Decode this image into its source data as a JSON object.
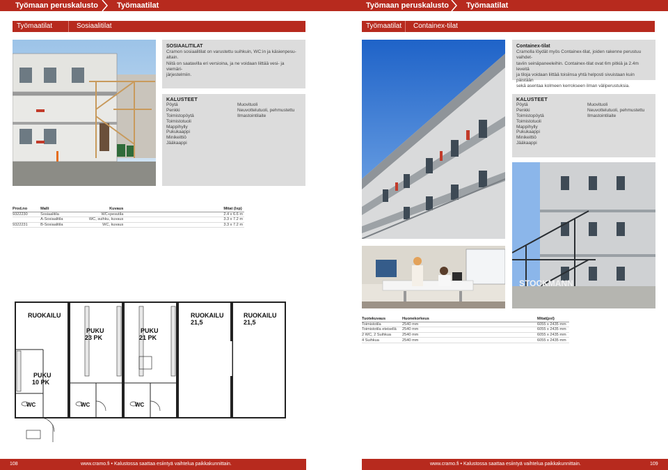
{
  "header": {
    "left_section": "Työmaan peruskalusto",
    "left_page": "Työmaatilat",
    "right_section": "Työmaan peruskalusto",
    "right_page": "Työmaatilat"
  },
  "left_page": {
    "bar_category": "Työmaatilat",
    "bar_subcategory": "Sosiaalitilat",
    "info_title": "SOSIAALITILAT",
    "info_text_1": "Cramon sosiaalitilat on varustettu suihkuin, WC:in ja käsienpesu-",
    "info_text_2": "altain.",
    "info_text_3": "Niitä on saatavilla eri versioina, ja ne voidaan liittää vesi- ja viemäri-",
    "info_text_4": "järjestelmiin.",
    "furniture_title": "KALUSTEET",
    "furniture_col1": [
      "Pöytä",
      "Penkki",
      "Toimistopöytä",
      "Toimistotuoli",
      "Mappihylly",
      "Pukukaappi",
      "Minikeittiö",
      "Jääkaappi"
    ],
    "furniture_col2": [
      "Muovituoli",
      "Neuvottelutuoli, pehmustettu",
      "Ilmastointilaite"
    ],
    "table_headers": [
      "Prod.no",
      "Malli",
      "Kuvaus",
      "Mitat (lxp)"
    ],
    "table_rows": [
      [
        "9322230",
        "Sosiaalitila",
        "WC+pesutila",
        "2.4 x 6.6 m"
      ],
      [
        "",
        "A-Sosiaalitila",
        "WC, suihku, kuvaus",
        "3.3 x 7.2 m"
      ],
      [
        "9322231",
        "B-Sosiaalitila",
        "WC, kuvaus",
        "3.3 x 7.2 m"
      ]
    ],
    "plan_labels": {
      "r1": "RUOKAILU",
      "r1b": "PUKU",
      "r1c": "10 PK",
      "r2": "PUKU",
      "r2b": "23 PK",
      "r3": "PUKU",
      "r3b": "21 PK",
      "r4": "RUOKAILU",
      "r4b": "21,5",
      "r5": "RUOKAILU",
      "r5b": "21,5",
      "wc": "WC"
    }
  },
  "right_page": {
    "bar_category": "Työmaatilat",
    "bar_subcategory": "Containex-tilat",
    "info_title": "Containex-tilat",
    "info_text_1": "Cramolla löydät myös Containex-tilat, joiden rakenne perustuu vaihdet-",
    "info_text_2": "taviin seinäpaneeleihin. Containex-tilat ovat 6m pitkiä ja 2.4m leveitä",
    "info_text_3": "ja tiloja voidaan liittää toisiinsa yhtä helposti sivuistaan kuin päistään",
    "info_text_4": "sekä asentaa kolmeen kerrokseen ilman väliperustuksia.",
    "furniture_title": "KALUSTEET",
    "furniture_col1": [
      "Pöytä",
      "Penkki",
      "Toimistopöytä",
      "Toimistotuoli",
      "Mappihylly",
      "Pukukaappi",
      "Minikeittiö",
      "Jääkaappi"
    ],
    "furniture_col2": [
      "Muovituoli",
      "Neuvottelutuoli, pehmustettu",
      "Ilmastointilaite"
    ],
    "table_headers": [
      "Tuotekuvaus",
      "Huonekorkeus",
      "",
      "Mitat(pxl)"
    ],
    "table_rows": [
      [
        "Toimistotila",
        "2540 mm",
        "",
        "6055 x 2435 mm"
      ],
      [
        "Toimistotila eteisellä",
        "2540 mm",
        "",
        "6055 x 2435 mm"
      ],
      [
        "2 WC, 2 Suihkua",
        "2540 mm",
        "",
        "6055 x 2435 mm"
      ],
      [
        "4 Suihkua",
        "2540 mm",
        "",
        "6055 x 2435 mm"
      ]
    ],
    "sign_text": "STOCKMANN"
  },
  "footer": {
    "left_page_no": "108",
    "left_text": "www.cramo.fi • Kalustossa saattaa esiintyä vaihtelua paikkakunnittain.",
    "right_text": "www.cramo.fi • Kalustossa saattaa esiintyä vaihtelua paikkakunnittain.",
    "right_page_no": "109"
  },
  "colors": {
    "brand_red": "#b72a1e",
    "grey_box": "#dcdcdc"
  }
}
